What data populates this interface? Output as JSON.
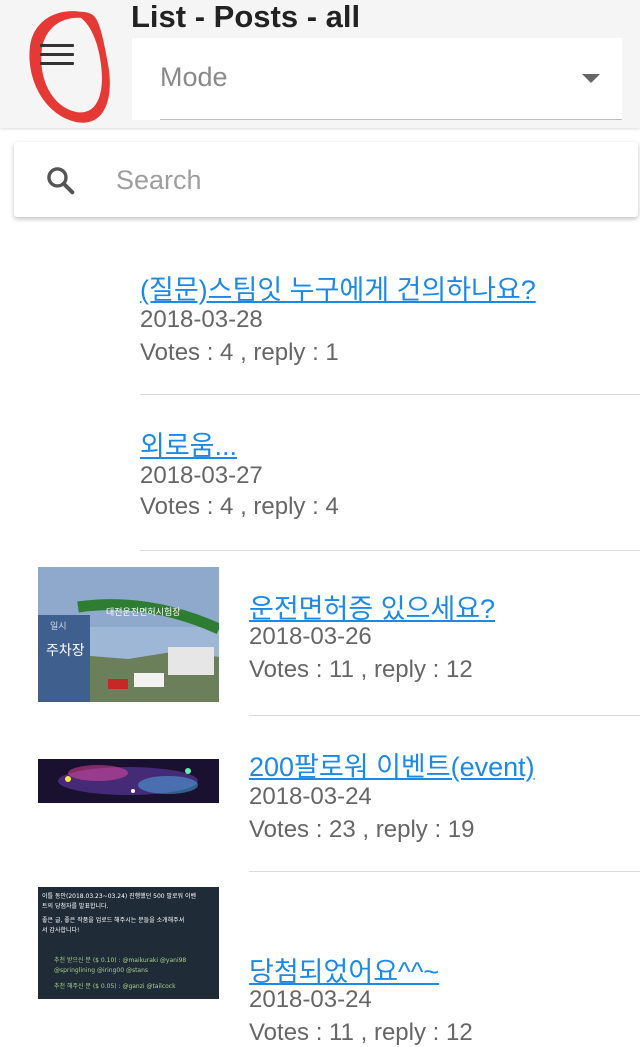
{
  "header": {
    "title": "List - Posts - all",
    "mode_label": "Mode"
  },
  "search": {
    "placeholder": "Search"
  },
  "posts": [
    {
      "title": "(질문)스팀잇 누구에게 건의하나요?",
      "date": "2018-03-28",
      "stats": "Votes : 4 , reply : 1"
    },
    {
      "title": "외로움...",
      "date": "2018-03-27",
      "stats": "Votes : 4 , reply : 4"
    },
    {
      "title": "운전면허증 있으세요?",
      "date": "2018-03-26",
      "stats": "Votes : 11 , reply : 12",
      "thumb": {
        "sign_text": "대전운전면허시험장",
        "post_text": "주차장",
        "post_top": "일시"
      }
    },
    {
      "title": "200팔로워 이벤트(event)",
      "date": "2018-03-24",
      "stats": "Votes : 23 , reply : 19"
    },
    {
      "title": "당첨되었어요^^~",
      "date": "2018-03-24",
      "stats": "Votes : 11 , reply : 12",
      "thumb": {
        "lines": [
          "이틀 동안(2018.03.23~03.24) 진행했던 500 팔로워 이벤",
          "트의 당첨자를 발표합니다.",
          "좋은 글, 좋은 작품을 업로드 해주시는 분들을 소개해주셔",
          "서 감사합니다!",
          "추천 받으신 분 ($ 0.10) : @maikuraki @yani98",
          "@springlining @iring00 @stans",
          "추천 해주신 분 ($ 0.05) : @ganzi @tailcock"
        ]
      }
    }
  ],
  "colors": {
    "link": "#1e88e5",
    "logo_red": "#e53935",
    "header_bg": "#f5f5f5"
  },
  "icons": {
    "menu": "hamburger-icon",
    "search": "magnifier-icon",
    "dropdown": "triangle-down-icon"
  }
}
